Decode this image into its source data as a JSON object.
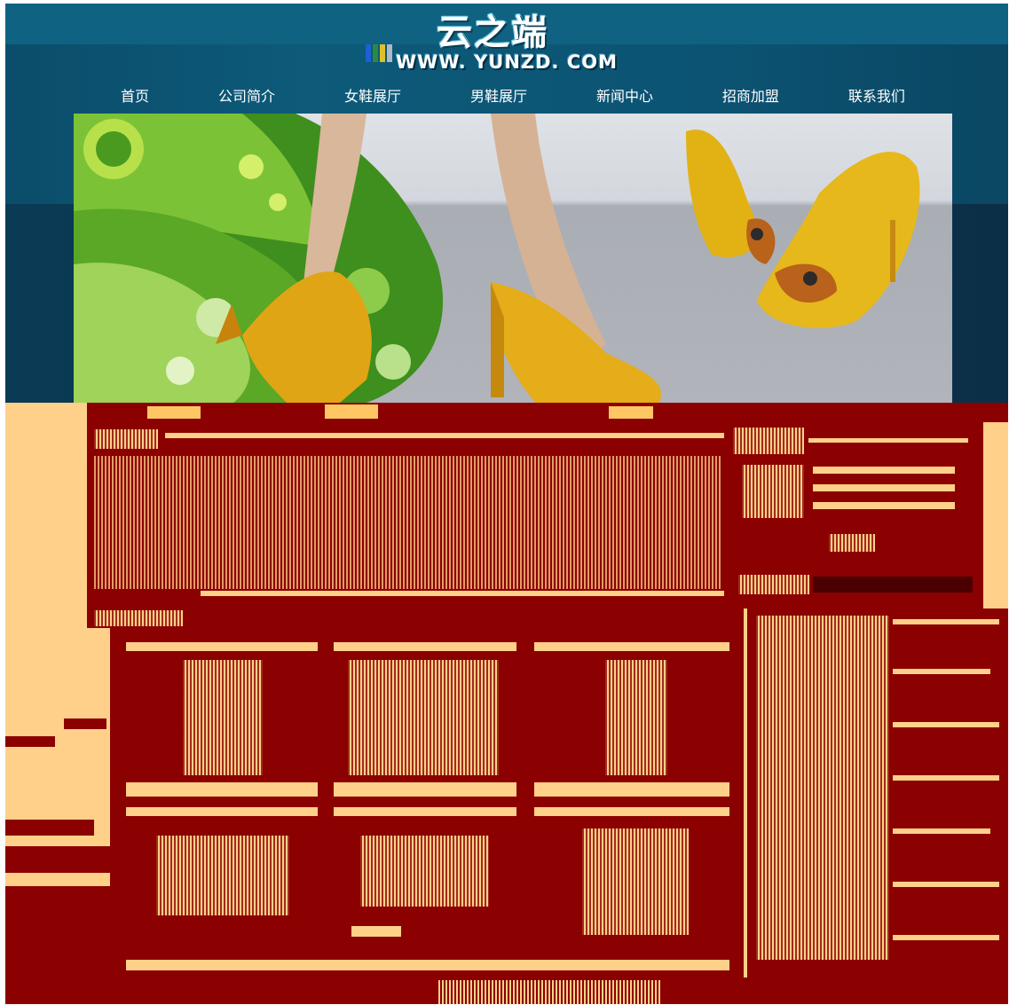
{
  "site": {
    "logo_text": "云之端",
    "url_text": "WWW. YUNZD. COM"
  },
  "nav": {
    "items": [
      "首页",
      "公司简介",
      "女鞋展厅",
      "男鞋展厅",
      "新闻中心",
      "招商加盟",
      "联系我们"
    ]
  },
  "banner": {
    "description_icon": "shoe-banner-image"
  },
  "colors": {
    "header_bg": "#0d5a79",
    "nav_text": "#ffffff",
    "content_bg": "#ffd089",
    "content_dark": "#8b0000"
  }
}
